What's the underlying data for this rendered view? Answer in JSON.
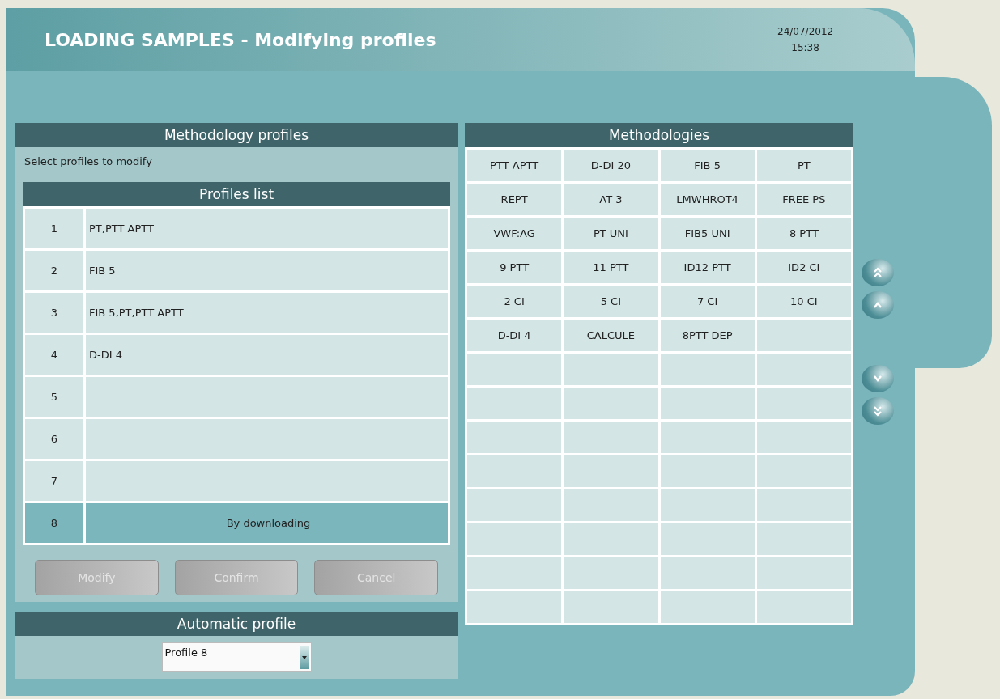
{
  "header": {
    "title": "LOADING SAMPLES - Modifying profiles",
    "date": "24/07/2012",
    "time": "15:38"
  },
  "methodology_profiles": {
    "title": "Methodology profiles",
    "instruction": "Select profiles to modify",
    "list_title": "Profiles list",
    "rows": [
      {
        "number": "1",
        "methodologies": "PT,PTT APTT",
        "selected": false
      },
      {
        "number": "2",
        "methodologies": "FIB 5",
        "selected": false
      },
      {
        "number": "3",
        "methodologies": "FIB 5,PT,PTT APTT",
        "selected": false
      },
      {
        "number": "4",
        "methodologies": "D-DI 4",
        "selected": false
      },
      {
        "number": "5",
        "selected": false
      },
      {
        "number": "6",
        "selected": false
      },
      {
        "number": "7",
        "selected": false
      },
      {
        "number": "8",
        "methodologies": "By downloading",
        "selected": true
      }
    ],
    "buttons": [
      {
        "label": "Modify",
        "disabled": true
      },
      {
        "label": "Confirm",
        "disabled": true
      },
      {
        "label": "Cancel",
        "disabled": true
      }
    ]
  },
  "automatic_profile": {
    "title": "Automatic profile",
    "value": "Profile 8"
  },
  "methodologies": {
    "title": "Methodologies",
    "cells": [
      "PTT APTT",
      "D-DI 20",
      "FIB 5",
      "PT",
      "REPT",
      "AT 3",
      "LMWHROT4",
      "FREE PS",
      "VWF:AG",
      "PT UNI",
      "FIB5 UNI",
      "8 PTT",
      "9 PTT",
      "11 PTT",
      "ID12 PTT",
      "ID2 CI",
      "2 CI",
      "5 CI",
      "7 CI",
      "10 CI",
      "D-DI 4",
      "CALCULE",
      "8PTT DEP"
    ]
  }
}
